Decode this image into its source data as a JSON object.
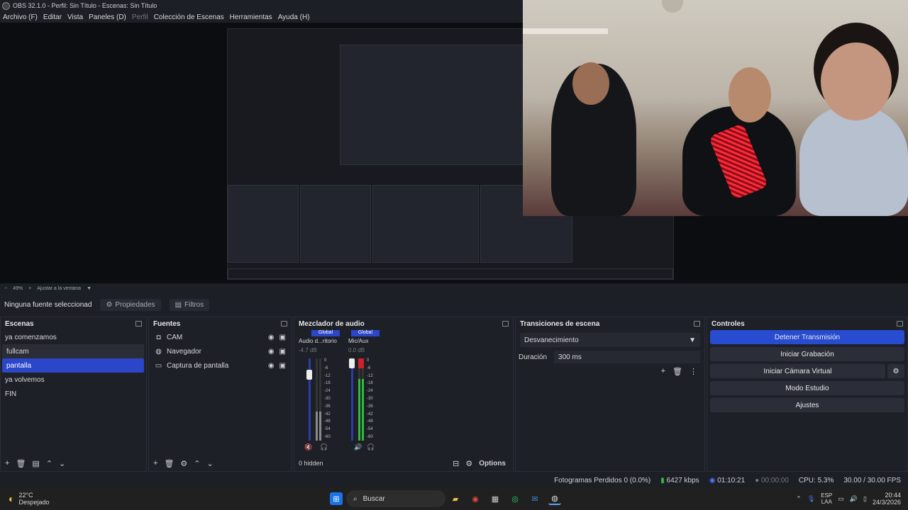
{
  "window": {
    "title": "OBS 32.1.0 - Perfil: Sin Título - Escenas: Sin Título"
  },
  "menu": [
    "Archivo (F)",
    "Editar",
    "Vista",
    "Paneles (D)",
    "Perfil",
    "Colección de Escenas",
    "Herramientas",
    "Ayuda (H)"
  ],
  "preview": {
    "zoom": "49%",
    "fit_label": "Ajustar a la ventana"
  },
  "props": {
    "no_source": "Ninguna fuente seleccionad",
    "properties": "Propiedades",
    "filters": "Filtros"
  },
  "scenes": {
    "header": "Escenas",
    "items": [
      "ya comenzamos",
      "fullcam",
      "pantalla",
      "ya volvemos",
      "FIN"
    ],
    "selected": "pantalla"
  },
  "sources": {
    "header": "Fuentes",
    "items": [
      {
        "name": "CAM",
        "icon": "camera-icon"
      },
      {
        "name": "Navegador",
        "icon": "globe-icon"
      },
      {
        "name": "Captura de pantalla",
        "icon": "monitor-icon"
      }
    ]
  },
  "mixer": {
    "header": "Mezclador de audio",
    "channels": [
      {
        "badge": "Global",
        "name": "Audio d...ritorio",
        "db": "-4.7 dB",
        "level": 0.35
      },
      {
        "badge": "Global",
        "name": "Mic/Aux",
        "db": "0.0 dB",
        "level": 0.75
      }
    ],
    "scale": [
      "0",
      "-6",
      "-12",
      "-18",
      "-24",
      "-30",
      "-36",
      "-42",
      "-48",
      "-54",
      "-60"
    ],
    "hidden": "0 hidden",
    "options": "Options"
  },
  "transitions": {
    "header": "Transiciones de escena",
    "selected": "Desvanecimiento",
    "duration_label": "Duración",
    "duration_value": "300 ms"
  },
  "controls": {
    "header": "Controles",
    "stop_stream": "Detener Transmisión",
    "start_recording": "Iniciar Grabación",
    "virtual_cam": "Iniciar Cámara Virtual",
    "studio_mode": "Modo Estudio",
    "settings": "Ajustes"
  },
  "status": {
    "dropped": "Fotogramas Perdidos 0 (0.0%)",
    "kbps": "6427 kbps",
    "stream_time": "01:10:21",
    "rec_time": "00:00:00",
    "cpu": "CPU: 5.3%",
    "fps": "30.00 / 30.00 FPS"
  },
  "taskbar": {
    "weather_temp": "22°C",
    "weather_desc": "Despejado",
    "search": "Buscar",
    "lang1": "ESP",
    "lang2": "LAA",
    "time": "20:44",
    "date": "24/3/2026"
  },
  "colors": {
    "accent": "#2b46c9",
    "bg": "#1d1f26",
    "meter_green": "#2fbd3a",
    "meter_red": "#d0202e"
  }
}
